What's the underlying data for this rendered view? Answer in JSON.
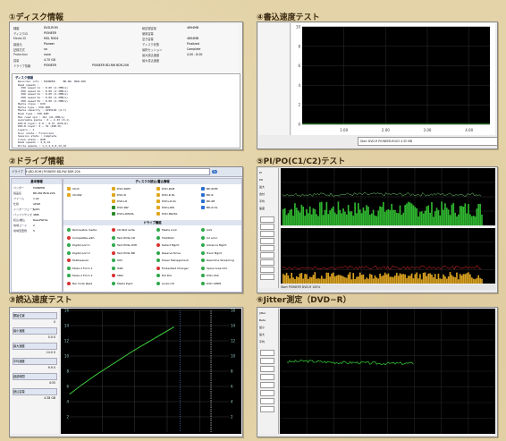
{
  "panels": {
    "p1": {
      "title": "①ディスク情報"
    },
    "p2": {
      "title": "②ドライブ情報"
    },
    "p3": {
      "title": "③読込速度テスト"
    },
    "p4": {
      "title": "④書込速度テスト"
    },
    "p5": {
      "title": "⑤PI/PO(C1/C2)テスト"
    },
    "p6": {
      "title": "⑥Jitter測定（DVD−R）"
    }
  },
  "disk_info": {
    "fields_left": [
      {
        "k": "種類",
        "v": "DVD-ROM"
      },
      {
        "k": "ディスクID",
        "v": "PIONEER"
      },
      {
        "k": "Media ID",
        "v": "MXL RG04"
      },
      {
        "k": "製造元",
        "v": "Pioneer"
      },
      {
        "k": "記録方式",
        "v": "no"
      },
      {
        "k": "Protection",
        "v": "none"
      },
      {
        "k": "容量",
        "v": "4.70 GB"
      },
      {
        "k": "ドライブ情報",
        "v": "PIONEER"
      }
    ],
    "fields_right": [
      {
        "k": "総記録容量",
        "v": "4694MB"
      },
      {
        "k": "使用容量",
        "v": ""
      },
      {
        "k": "空き容量",
        "v": "4694MB"
      },
      {
        "k": "ディスク状態",
        "v": "Finalized"
      },
      {
        "k": "最終セッション",
        "v": "Complete"
      },
      {
        "k": "最大読込速度",
        "v": "4.00 - 8.00"
      },
      {
        "k": "最大書込速度",
        "v": ""
      }
    ],
    "drive_line": "PIONEER    BD-RW BDR-206",
    "tree_title": "ディスク情報",
    "tree_lines": [
      "Recorder info : PIONEER     BD-RW  BDR-206",
      "Read speeds :",
      "  DVD speed 1x : 8.00 (2.3MB/s)",
      "  DVD speed 2x : 8.00 (2.3MB/s)",
      "  DVD speed 4x : 8.00 (2.3MB/s)",
      "  DVD speed 6x : 8.00 (2.3MB/s)",
      "  DVD speed 8x : 8.00 (2.3MB/s)",
      "Media class : DVD",
      "Media type : DVD-ROM",
      "Media capacity : 2295104 (4.7)",
      "Book type : DVD-ROM",
      "Max read spd : 16x (21.1MB/s)",
      "Available media : 0 ~ 2.33 (0-1)",
      "DVD-R layer: 0.0 ~ 8.97 (DVD-R)",
      "DVD-R layer: 0 ~ 32 (DVD-R)",
      "Layers : 1",
      "Disc state : Finalized",
      "Session state : Complete",
      "Track state : ROM",
      "Read speeds : 4,8,16",
      "Write speeds : 1,2,4,6,8,12,16"
    ]
  },
  "drive_info": {
    "toolbar": {
      "label": "ドライブ",
      "drive": "E:[BD-ROM] PIONEER BD-RW BDR-206",
      "refresh": "↻"
    },
    "header_left": "基本情報",
    "left_fields": [
      {
        "k": "ベンダー",
        "v": "PIONEER"
      },
      {
        "k": "製品名",
        "v": "BD-RW BDR-206"
      },
      {
        "k": "ファーム",
        "v": "1.02"
      },
      {
        "k": "仕様",
        "v": "ATAPI"
      },
      {
        "k": "インターフェース",
        "v": "SATA"
      },
      {
        "k": "バッファサイズ",
        "v": "4MB"
      },
      {
        "k": "読込/書込",
        "v": "Read/Write"
      },
      {
        "k": "地域コード",
        "v": "2"
      },
      {
        "k": "地域変更残",
        "v": "5"
      }
    ],
    "read_header": "ディスクの読込/書込情報",
    "media_rows": [
      [
        "CD-R",
        "DVD-ROM",
        "DVD-RAM",
        "BD-ROM"
      ],
      [
        "CD-RW",
        "DVD-R",
        "DVD-R DL",
        "BD-R"
      ],
      [
        "",
        "DVD+R",
        "DVD+R DL",
        "BD-RE"
      ],
      [
        "",
        "DVD-RW",
        "DVD+RW",
        "BD-R DL"
      ],
      [
        "",
        "DVD+RW/DL",
        "DVD-RW/DL",
        ""
      ]
    ],
    "feature_header": "ドライブ機能",
    "features": [
      [
        "Removable media",
        "CD-Text write",
        "Media Lock",
        "AAS"
      ],
      [
        "Compatible with",
        "Test Write CD",
        "TAO/DAO",
        "C2 error"
      ],
      [
        "Digital port 1",
        "Test Write DVD",
        "Defect Mgmt",
        "Advance Mgmt"
      ],
      [
        "Digital port 2",
        "Test Write BD",
        "Reserve Drive",
        "Track Mgmt"
      ],
      [
        "Multisession",
        "UPC",
        "Power Management",
        "Real-time Streaming"
      ],
      [
        "Mode 2 Form 1",
        "ISRC",
        "Embedded Changer",
        "Spare Area Info"
      ],
      [
        "Mode 2 Form 2",
        "SMD",
        "Ext Poll",
        "DVD-CSS"
      ],
      [
        "Bar Code Read",
        "Media Eject",
        "Audio CD",
        "DVD CPRM"
      ]
    ]
  },
  "read_test": {
    "side_fields": [
      {
        "k": "開始位置",
        "v": "0"
      },
      {
        "k": "最小速度",
        "v": "5.0 X"
      },
      {
        "k": "最大速度",
        "v": "14.0 X"
      },
      {
        "k": "平均速度",
        "v": "9.9 X"
      },
      {
        "k": "経過時間",
        "v": "4:35"
      },
      {
        "k": "読込容量",
        "v": "4.38 GB"
      }
    ]
  },
  "write_test": {
    "status": "Start  DVD-R  PIONEER-RG03  4.35 MB"
  },
  "pipo": {
    "side_labels": [
      "PI",
      "PO",
      "最大",
      "合計",
      "平均",
      "速度"
    ],
    "footer": "Start   PIONEER DVD-R   100%"
  },
  "jitter": {
    "side_labels": [
      "Jitter",
      "Beta",
      "最小",
      "最大",
      "平均"
    ]
  },
  "chart_data": [
    {
      "type": "line",
      "name_hint": "read speed",
      "x": [
        0,
        0.5,
        1,
        1.5,
        2,
        2.5,
        3,
        3.5,
        4
      ],
      "series": [
        {
          "values": [
            5.0,
            6.3,
            7.5,
            8.6,
            9.7,
            10.8,
            11.8,
            12.8,
            13.8
          ]
        }
      ],
      "yticks": [
        "2",
        "4",
        "6",
        "8",
        "10",
        "12",
        "14",
        "16"
      ],
      "ylim": [
        0,
        16
      ]
    },
    {
      "type": "line",
      "name_hint": "write speed",
      "yticks": [
        "0",
        "2",
        "4",
        "6",
        "8",
        "10"
      ],
      "xticks": [
        "1.00",
        "2.00",
        "3.00",
        "4.00"
      ],
      "xlim": [
        0,
        4.5
      ],
      "ylim": [
        0,
        10
      ]
    },
    {
      "type": "bar",
      "name_hint": "PI errors",
      "ylim": [
        0,
        150
      ],
      "level": 0.3
    },
    {
      "type": "bar",
      "name_hint": "PO errors",
      "ylim": [
        0,
        16
      ],
      "level": 0.15
    },
    {
      "type": "line",
      "name_hint": "jitter",
      "ylim": [
        0,
        16
      ],
      "values": [
        9.2,
        9.3,
        9.2,
        9.1,
        9.1,
        9.0,
        9.0,
        9.0
      ]
    }
  ]
}
